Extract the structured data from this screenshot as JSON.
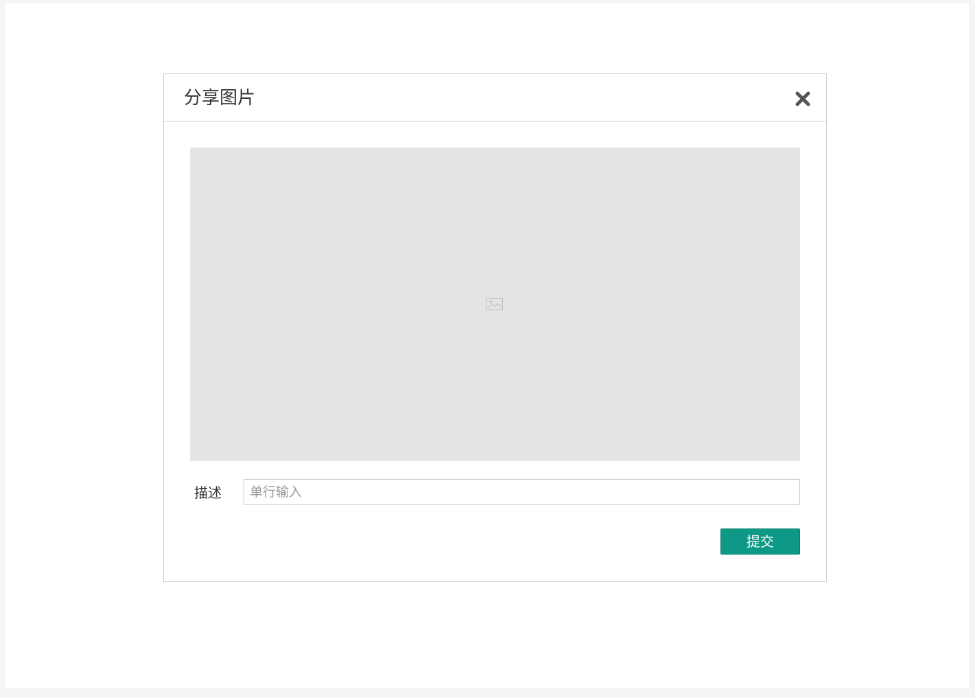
{
  "dialog": {
    "title": "分享图片",
    "close_icon": "close-icon",
    "image_placeholder_icon": "image-icon"
  },
  "form": {
    "description_label": "描述",
    "description_placeholder": "单行输入",
    "description_value": "",
    "submit_label": "提交"
  },
  "colors": {
    "accent": "#0e9886",
    "placeholder_bg": "#e4e4e4",
    "border": "#cfcfcf"
  }
}
